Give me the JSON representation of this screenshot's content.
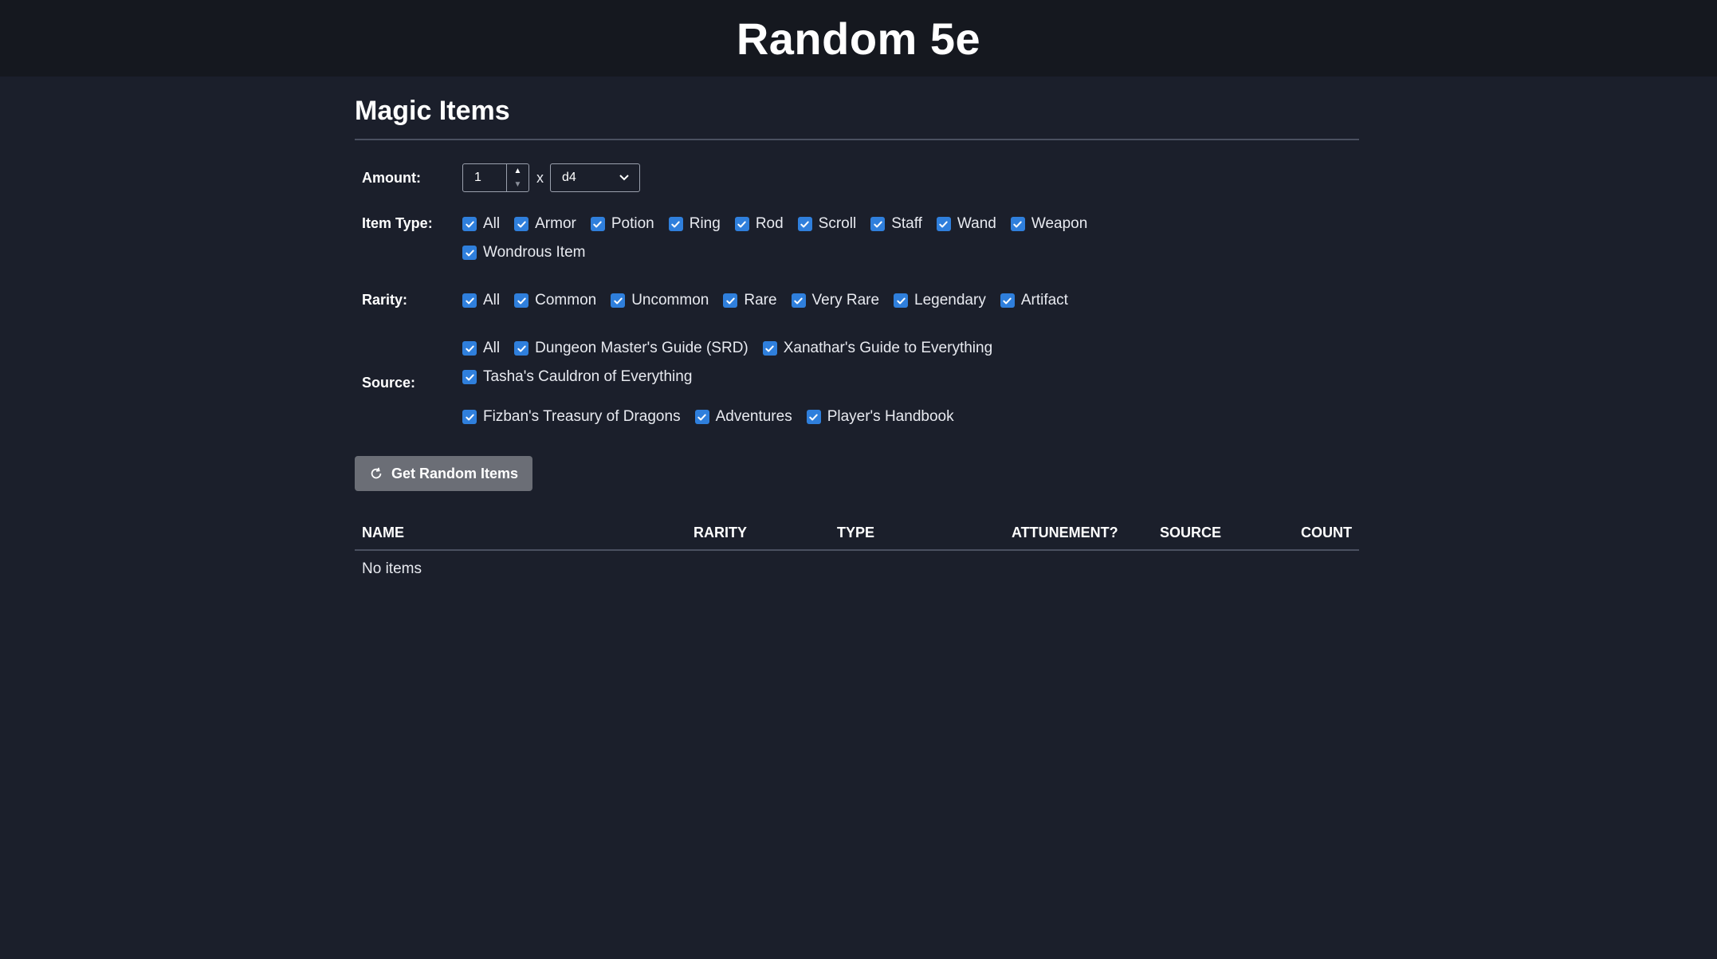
{
  "app": {
    "title": "Random 5e"
  },
  "page": {
    "title": "Magic Items"
  },
  "amount": {
    "label": "Amount:",
    "value": "1",
    "times": "x",
    "die": "d4"
  },
  "item_type": {
    "label": "Item Type:",
    "options": [
      "All",
      "Armor",
      "Potion",
      "Ring",
      "Rod",
      "Scroll",
      "Staff",
      "Wand",
      "Weapon",
      "Wondrous Item"
    ]
  },
  "rarity": {
    "label": "Rarity:",
    "options": [
      "All",
      "Common",
      "Uncommon",
      "Rare",
      "Very Rare",
      "Legendary",
      "Artifact"
    ]
  },
  "source": {
    "label": "Source:",
    "options": [
      "All",
      "Dungeon Master's Guide (SRD)",
      "Xanathar's Guide to Everything",
      "Tasha's Cauldron of Everything",
      "Fizban's Treasury of Dragons",
      "Adventures",
      "Player's Handbook"
    ]
  },
  "button": {
    "label": "Get Random Items",
    "icon": "refresh-icon"
  },
  "table": {
    "headers": [
      "NAME",
      "RARITY",
      "TYPE",
      "ATTUNEMENT?",
      "SOURCE",
      "COUNT"
    ],
    "empty_text": "No items"
  },
  "colors": {
    "accent": "#2f7fdc",
    "background": "#1b1f2b",
    "header": "#15181f",
    "button": "#6b6e76"
  }
}
